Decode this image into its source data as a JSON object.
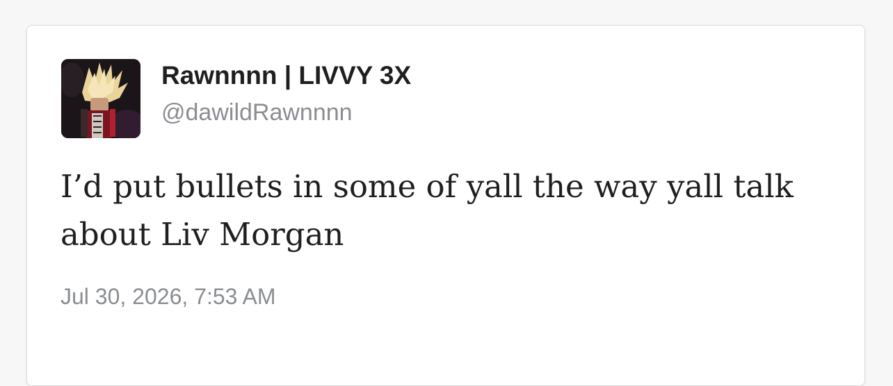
{
  "tweet": {
    "display_name": "Rawnnnn | LIVVY 3X",
    "handle": "@dawildRawnnnn",
    "text": "I’d put bullets in some of yall the way yall talk about Liv Morgan",
    "timestamp": "Jul 30, 2026, 7:53 AM"
  },
  "colors": {
    "card_bg": "#ffffff",
    "text_primary": "#1f1f1f",
    "text_secondary": "#8a8d91"
  },
  "icons": {
    "avatar": "profile-photo"
  }
}
